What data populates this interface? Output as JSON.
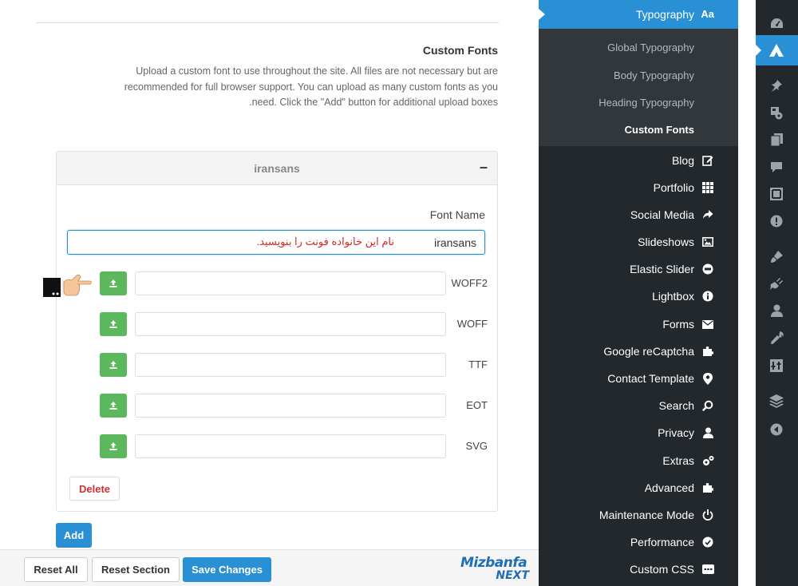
{
  "section": {
    "title": "Custom Fonts",
    "description": "Upload a custom font to use throughout the site. All files are not necessary but are recommended for full browser support. You can upload as many custom fonts as you need. Click the \"Add\" button for additional upload boxes."
  },
  "font_box": {
    "title": "iransans",
    "collapse_symbol": "–",
    "font_name_label": "Font Name",
    "font_name_value": "iransans",
    "font_name_note": "نام این خانواده فونت را بنویسید.",
    "uploads": [
      {
        "label": "WOFF2",
        "value": ""
      },
      {
        "label": "WOFF",
        "value": ""
      },
      {
        "label": "TTF",
        "value": ""
      },
      {
        "label": "EOT",
        "value": ""
      },
      {
        "label": "SVG",
        "value": ""
      }
    ],
    "delete_label": "Delete"
  },
  "add_label": "Add",
  "bottom_bar": {
    "reset_all": "Reset All",
    "reset_section": "Reset Section",
    "save_changes": "Save Changes",
    "logo_top": "Mizbanfa",
    "logo_bottom": "NEXT"
  },
  "options_sidebar": {
    "active": {
      "label": "Typography",
      "icon_text": "Aa",
      "icon": "typography-icon"
    },
    "sub_items": [
      {
        "label": "Global Typography"
      },
      {
        "label": "Body Typography"
      },
      {
        "label": "Heading Typography"
      },
      {
        "label": "Custom Fonts"
      }
    ],
    "items": [
      {
        "label": "Blog",
        "icon": "edit-icon"
      },
      {
        "label": "Portfolio",
        "icon": "grid-icon"
      },
      {
        "label": "Social Media",
        "icon": "share-icon"
      },
      {
        "label": "Slideshows",
        "icon": "image-icon"
      },
      {
        "label": "Elastic Slider",
        "icon": "slider-icon"
      },
      {
        "label": "Lightbox",
        "icon": "info-icon"
      },
      {
        "label": "Forms",
        "icon": "envelope-icon"
      },
      {
        "label": "Google reCaptcha",
        "icon": "puzzle-icon"
      },
      {
        "label": "Contact Template",
        "icon": "map-pin-icon"
      },
      {
        "label": "Search",
        "icon": "search-icon"
      },
      {
        "label": "Privacy",
        "icon": "user-icon"
      },
      {
        "label": "Extras",
        "icon": "gears-icon"
      },
      {
        "label": "Advanced",
        "icon": "puzzle-icon"
      },
      {
        "label": "Maintenance Mode",
        "icon": "power-icon"
      },
      {
        "label": "Performance",
        "icon": "gauge-icon"
      },
      {
        "label": "Custom CSS",
        "icon": "css-icon"
      }
    ]
  },
  "admin_bar_icons": [
    "dashboard-icon",
    "avada-icon",
    "pin-icon",
    "media-icon",
    "pages-icon",
    "comments-icon",
    "portfolio-icon",
    "alert-icon",
    "appearance-icon",
    "plugins-icon",
    "users-icon",
    "tools-icon",
    "settings-icon",
    "layers-icon",
    "collapse-icon"
  ]
}
